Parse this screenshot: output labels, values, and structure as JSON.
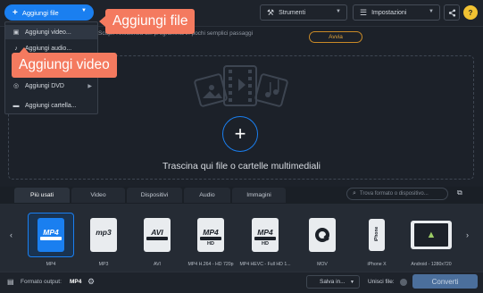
{
  "toolbar": {
    "add_files_label": "Aggiungi file",
    "tools_label": "Strumenti",
    "settings_label": "Impostazioni",
    "help_label": "?"
  },
  "info": {
    "text": "Scopri l'efficienza del programma in pochi semplici passaggi",
    "start_label": "Avvia"
  },
  "add_menu": {
    "items": [
      {
        "label": "Aggiungi video...",
        "icon": "film-icon",
        "has_submenu": false
      },
      {
        "label": "Aggiungi audio...",
        "icon": "music-note-icon",
        "has_submenu": false
      },
      {
        "label": "",
        "icon": "image-icon",
        "has_submenu": false
      },
      {
        "label": "Aggiungi DVD",
        "icon": "disc-icon",
        "has_submenu": true
      },
      {
        "label": "Aggiungi cartella...",
        "icon": "folder-icon",
        "has_submenu": false
      }
    ]
  },
  "callouts": {
    "add_files": "Aggiungi file",
    "add_video": "Aggiungi video"
  },
  "drop_zone": {
    "text": "Trascina qui file o cartelle multimediali"
  },
  "tabs": [
    "Più usati",
    "Video",
    "Dispositivi",
    "Audio",
    "Immagini"
  ],
  "active_tab": 0,
  "search": {
    "placeholder": "Trova formato o dispositivo..."
  },
  "formats": [
    {
      "name": "MP4",
      "icon_label": "MP4",
      "hd": "",
      "active": true
    },
    {
      "name": "MP3",
      "icon_label": "mp3",
      "hd": "",
      "active": false
    },
    {
      "name": "AVI",
      "icon_label": "AVI",
      "hd": "",
      "active": false
    },
    {
      "name": "MP4 H.264 - HD 720p",
      "icon_label": "MP4",
      "hd": "HD",
      "active": false
    },
    {
      "name": "MP4 HEVC - Full HD 1...",
      "icon_label": "MP4",
      "hd": "HD",
      "active": false
    },
    {
      "name": "MOV",
      "icon_label": "",
      "hd": "",
      "active": false
    },
    {
      "name": "iPhone X",
      "icon_label": "iPhone",
      "hd": "",
      "active": false
    },
    {
      "name": "Android - 1280x720",
      "icon_label": "",
      "hd": "",
      "active": false
    }
  ],
  "bottom": {
    "output_label": "Formato output:",
    "output_value": "MP4",
    "save_label": "Salva in...",
    "merge_label": "Unisci file:",
    "convert_label": "Converti"
  },
  "colors": {
    "accent": "#1a7ff0",
    "callout": "#f47a5f",
    "start_border": "#c98a27",
    "help_bg": "#f1c232"
  }
}
